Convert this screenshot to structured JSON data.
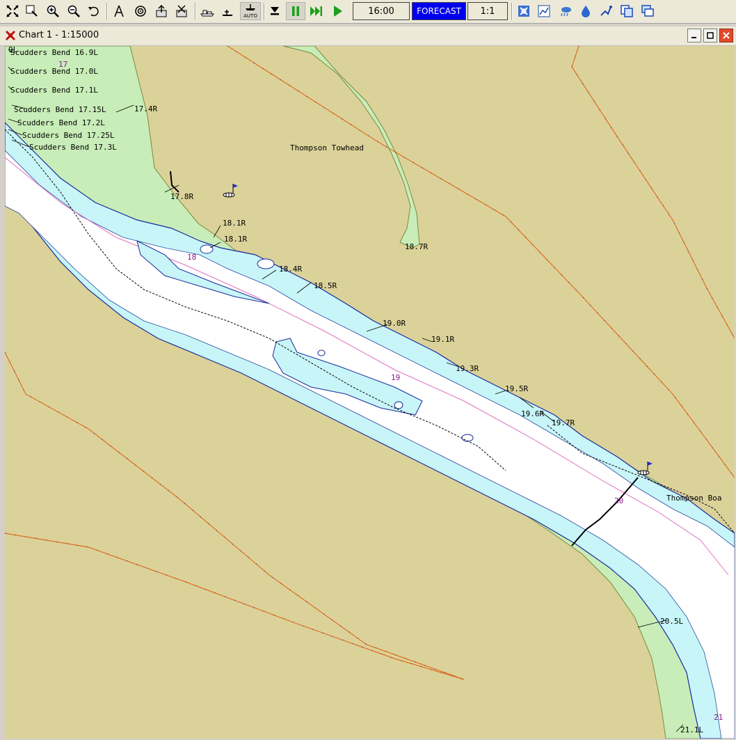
{
  "toolbar": {
    "time": "16:00",
    "forecast_label": "FORECAST",
    "scale_ratio": "1:1",
    "auto_label": "AUTO"
  },
  "window": {
    "title": "Chart 1 - 1:15000"
  },
  "map": {
    "colors": {
      "land": "#dbd29a",
      "shallow": "#c8edb8",
      "medium": "#c8f5f8",
      "deep": "#ffffff",
      "boundary": "#e07020"
    },
    "top_left_label": "9L",
    "river_miles": [
      "17",
      "18",
      "19",
      "20",
      "21"
    ],
    "place_names": [
      "Thompson Towhead",
      "Thompson Boa"
    ],
    "mile_markers_left": [
      "Scudders Bend 16.9L",
      "Scudders Bend 17.0L",
      "Scudders Bend 17.1L",
      "Scudders Bend 17.15L",
      "Scudders Bend 17.2L",
      "Scudders Bend 17.25L",
      "Scudders Bend 17.3L"
    ],
    "mile_markers": [
      "17.4R",
      "17.8R",
      "18.1R",
      "18.1R",
      "18.4R",
      "18.5R",
      "18.7R",
      "19.0R",
      "19.1R",
      "19.3R",
      "19.5R",
      "19.6R",
      "19.7R",
      "20.5L",
      "21.1L"
    ]
  }
}
